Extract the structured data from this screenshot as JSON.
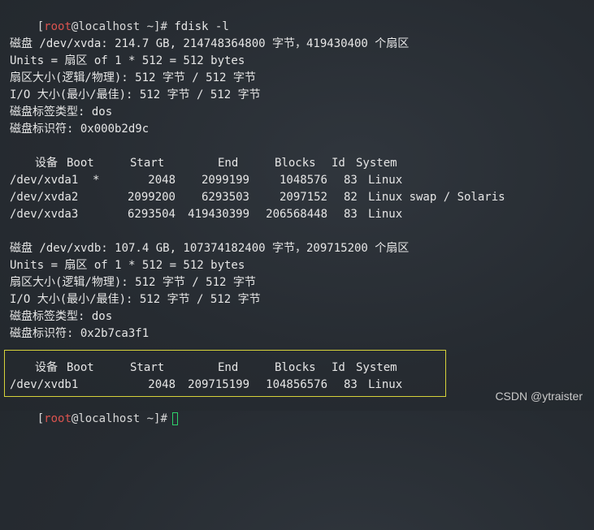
{
  "prompt": {
    "open": "[",
    "user": "root",
    "at": "@",
    "host": "localhost",
    "path": " ~",
    "close": "]#"
  },
  "command": "fdisk -l",
  "disk1": {
    "header": "磁盘 /dev/xvda: 214.7 GB, 214748364800 字节，419430400 个扇区",
    "units": "Units = 扇区 of 1 * 512 = 512 bytes",
    "sector_size": "扇区大小(逻辑/物理): 512 字节 / 512 字节",
    "io_size": "I/O 大小(最小/最佳): 512 字节 / 512 字节",
    "label_type": "磁盘标签类型: dos",
    "identifier": "磁盘标识符: 0x000b2d9c"
  },
  "table_headers": {
    "device": "设备",
    "boot": "Boot",
    "start": "Start",
    "end": "End",
    "blocks": "Blocks",
    "id": "Id",
    "system": "System"
  },
  "partitions1": [
    {
      "device": "/dev/xvda1",
      "boot": "*",
      "start": "2048",
      "end": "2099199",
      "blocks": "1048576",
      "id": "83",
      "system": "Linux"
    },
    {
      "device": "/dev/xvda2",
      "boot": "",
      "start": "2099200",
      "end": "6293503",
      "blocks": "2097152",
      "id": "82",
      "system": "Linux swap / Solaris"
    },
    {
      "device": "/dev/xvda3",
      "boot": "",
      "start": "6293504",
      "end": "419430399",
      "blocks": "206568448",
      "id": "83",
      "system": "Linux"
    }
  ],
  "disk2": {
    "header": "磁盘 /dev/xvdb: 107.4 GB, 107374182400 字节，209715200 个扇区",
    "units": "Units = 扇区 of 1 * 512 = 512 bytes",
    "sector_size": "扇区大小(逻辑/物理): 512 字节 / 512 字节",
    "io_size": "I/O 大小(最小/最佳): 512 字节 / 512 字节",
    "label_type": "磁盘标签类型: dos",
    "identifier": "磁盘标识符: 0x2b7ca3f1"
  },
  "partitions2": [
    {
      "device": "/dev/xvdb1",
      "boot": "",
      "start": "2048",
      "end": "209715199",
      "blocks": "104856576",
      "id": "83",
      "system": "Linux"
    }
  ],
  "watermark": "CSDN @ytraister",
  "colors": {
    "prompt_user": "#d9534f",
    "highlight_border": "#d6d23a",
    "cursor": "#2fd16b"
  }
}
